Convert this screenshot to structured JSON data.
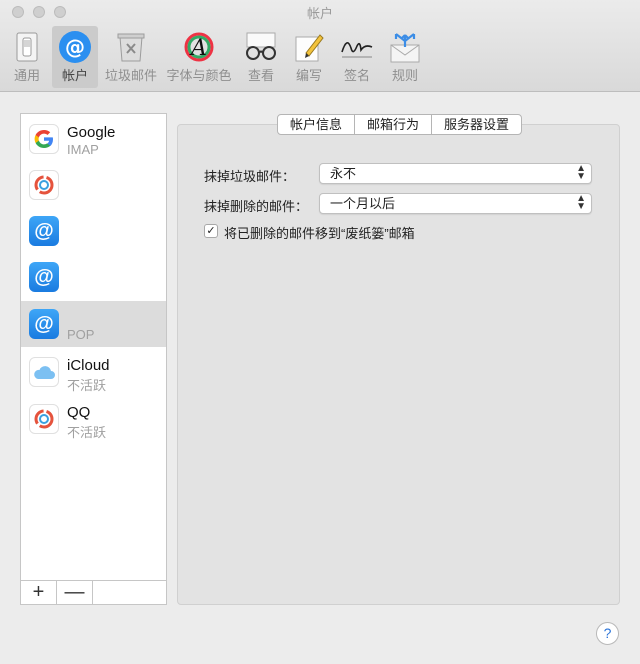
{
  "window": {
    "title": "帐户"
  },
  "toolbar": {
    "items": [
      {
        "label": "通用",
        "icon": "light-switch-icon"
      },
      {
        "label": "帐户",
        "icon": "at-sign-icon",
        "selected": true
      },
      {
        "label": "垃圾邮件",
        "icon": "trash-bin-icon"
      },
      {
        "label": "字体与颜色",
        "icon": "font-color-icon"
      },
      {
        "label": "查看",
        "icon": "glasses-icon"
      },
      {
        "label": "编写",
        "icon": "pencil-paper-icon"
      },
      {
        "label": "签名",
        "icon": "signature-icon"
      },
      {
        "label": "规则",
        "icon": "rules-envelope-icon"
      }
    ]
  },
  "accounts": [
    {
      "name": "Google",
      "sub": "IMAP",
      "icon": "google-icon"
    },
    {
      "name": "",
      "sub": "",
      "icon": "exchange-icon"
    },
    {
      "name": "",
      "sub": "",
      "icon": "at-sign-icon"
    },
    {
      "name": "",
      "sub": "",
      "icon": "at-sign-icon"
    },
    {
      "name": "",
      "sub": "POP",
      "icon": "at-sign-icon",
      "selected": true
    },
    {
      "name": "iCloud",
      "sub": "不活跃",
      "icon": "icloud-icon"
    },
    {
      "name": "QQ",
      "sub": "不活跃",
      "icon": "qq-icon"
    }
  ],
  "list_controls": {
    "add": "+",
    "remove": "—"
  },
  "tabs": [
    {
      "label": "帐户信息"
    },
    {
      "label": "邮箱行为",
      "active": true
    },
    {
      "label": "服务器设置"
    }
  ],
  "settings": {
    "erase_junk_label": "抹掉垃圾邮件：",
    "erase_junk_value": "永不",
    "erase_deleted_label": "抹掉删除的邮件：",
    "erase_deleted_value": "一个月以后",
    "move_to_trash_label": "将已删除的邮件移到“废纸篓”邮箱",
    "move_to_trash_checked": true
  },
  "help": {
    "label": "?"
  }
}
